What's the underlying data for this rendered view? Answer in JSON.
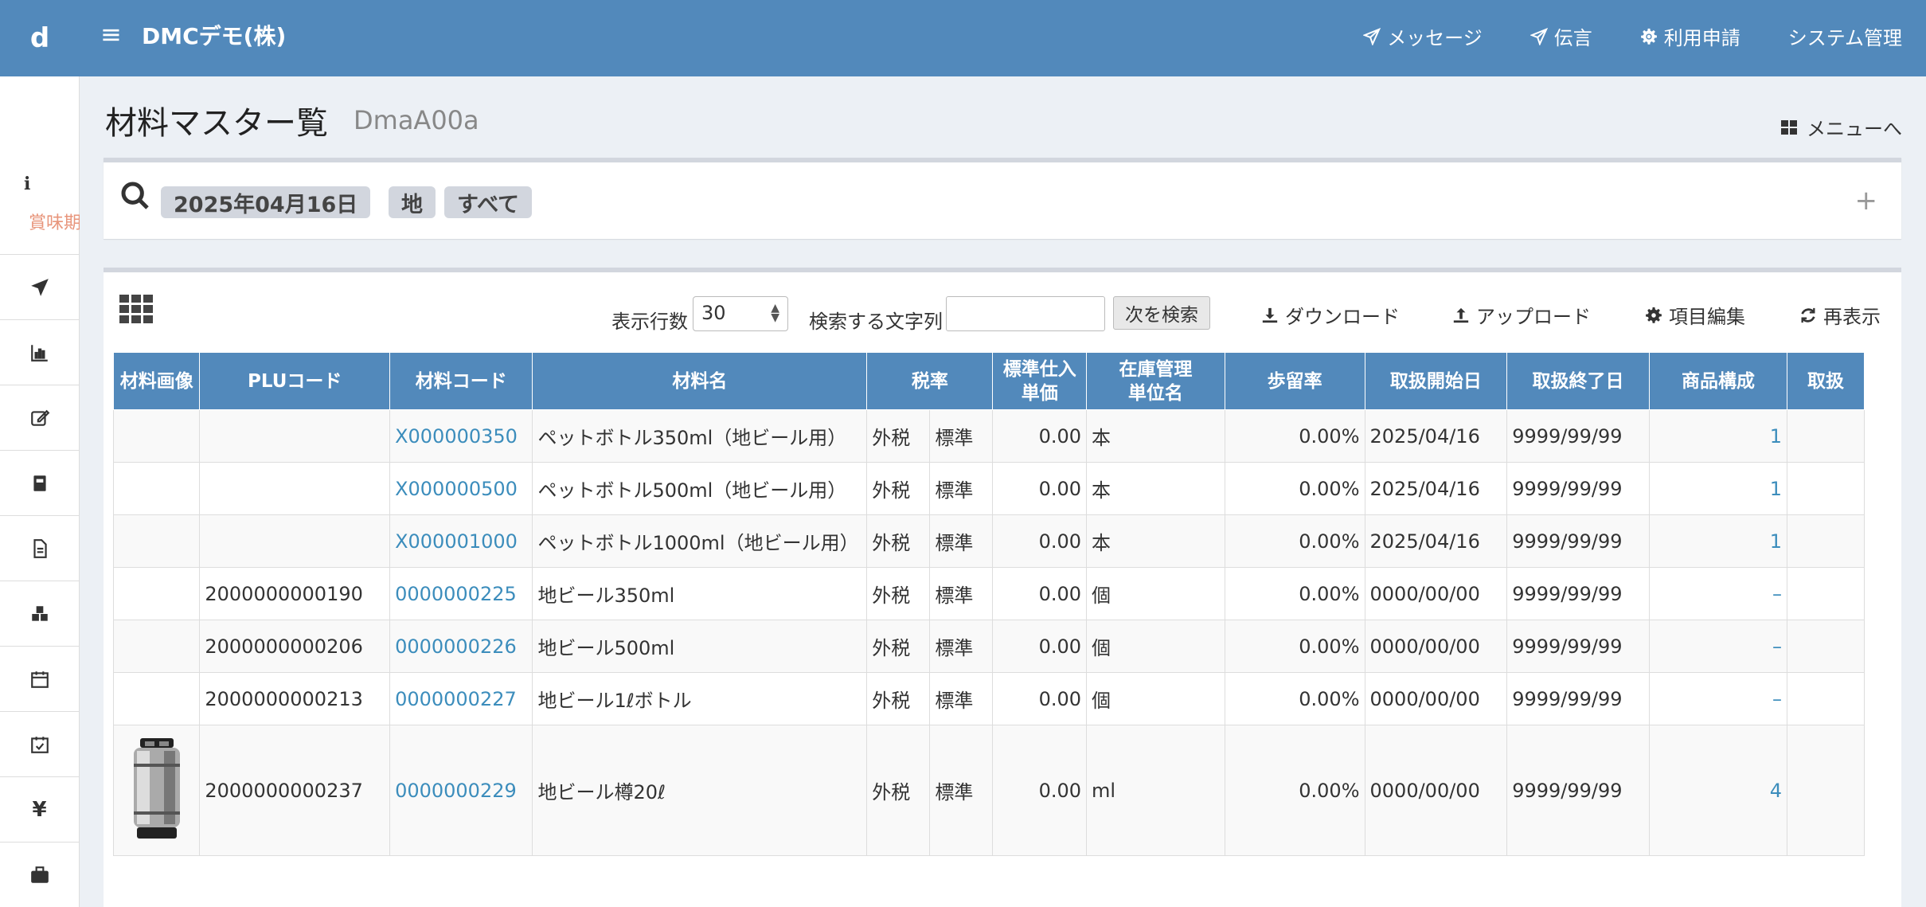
{
  "app": {
    "logo": "d",
    "company": "DMCデモ(株)",
    "nav": [
      {
        "label": "メッセージ",
        "icon": "send-icon"
      },
      {
        "label": "伝言",
        "icon": "send-icon"
      },
      {
        "label": "利用申請",
        "icon": "gear-icon"
      },
      {
        "label": "システム管理",
        "icon": ""
      }
    ]
  },
  "sidebar": {
    "info_label": "i",
    "expiry_label": "賞味期限",
    "items": [
      "send-icon",
      "bar-chart-icon",
      "edit-icon",
      "book-icon",
      "document-icon",
      "cubes-icon",
      "calendar-icon",
      "calendar-check-icon",
      "yen-icon",
      "briefcase-icon"
    ]
  },
  "page": {
    "title": "材料マスター覧",
    "code": "DmaA00a",
    "menu_link": "メニューへ"
  },
  "search": {
    "chips": [
      "2025年04月16日",
      "地",
      "すべて"
    ],
    "expand": "+"
  },
  "toolbar": {
    "rows_label": "表示行数",
    "rows_value": "30",
    "search_label": "検索する文字列",
    "search_value": "",
    "next_button": "次を検索",
    "download": "ダウンロード",
    "upload": "アップロード",
    "edit_items": "項目編集",
    "refresh": "再表示"
  },
  "table": {
    "headers": [
      "材料画像",
      "PLUコード",
      "材料コード",
      "材料名",
      "税率",
      "標準仕入\n単価",
      "在庫管理\n単位名",
      "歩留率",
      "取扱開始日",
      "取扱終了日",
      "商品構成",
      "取扱"
    ],
    "rows": [
      {
        "image": false,
        "plu": "",
        "code": "X000000350",
        "name": "ペットボトル350ml（地ビール用）",
        "tax1": "外税",
        "tax2": "標準",
        "price": "0.00",
        "unit": "本",
        "yield": "0.00%",
        "start": "2025/04/16",
        "end": "9999/99/99",
        "composition": "1"
      },
      {
        "image": false,
        "plu": "",
        "code": "X000000500",
        "name": "ペットボトル500ml（地ビール用）",
        "tax1": "外税",
        "tax2": "標準",
        "price": "0.00",
        "unit": "本",
        "yield": "0.00%",
        "start": "2025/04/16",
        "end": "9999/99/99",
        "composition": "1"
      },
      {
        "image": false,
        "plu": "",
        "code": "X000001000",
        "name": "ペットボトル1000ml（地ビール用）",
        "tax1": "外税",
        "tax2": "標準",
        "price": "0.00",
        "unit": "本",
        "yield": "0.00%",
        "start": "2025/04/16",
        "end": "9999/99/99",
        "composition": "1"
      },
      {
        "image": false,
        "plu": "2000000000190",
        "code": "0000000225",
        "name": "地ビール350ml",
        "tax1": "外税",
        "tax2": "標準",
        "price": "0.00",
        "unit": "個",
        "yield": "0.00%",
        "start": "0000/00/00",
        "end": "9999/99/99",
        "composition": "–"
      },
      {
        "image": false,
        "plu": "2000000000206",
        "code": "0000000226",
        "name": "地ビール500ml",
        "tax1": "外税",
        "tax2": "標準",
        "price": "0.00",
        "unit": "個",
        "yield": "0.00%",
        "start": "0000/00/00",
        "end": "9999/99/99",
        "composition": "–"
      },
      {
        "image": false,
        "plu": "2000000000213",
        "code": "0000000227",
        "name": "地ビール1ℓボトル",
        "tax1": "外税",
        "tax2": "標準",
        "price": "0.00",
        "unit": "個",
        "yield": "0.00%",
        "start": "0000/00/00",
        "end": "9999/99/99",
        "composition": "–"
      },
      {
        "image": true,
        "plu": "2000000000237",
        "code": "0000000229",
        "name": "地ビール樽20ℓ",
        "tax1": "外税",
        "tax2": "標準",
        "price": "0.00",
        "unit": "ml",
        "yield": "0.00%",
        "start": "0000/00/00",
        "end": "9999/99/99",
        "composition": "4"
      }
    ]
  },
  "colors": {
    "header": "#5289bb",
    "link": "#3c8dbc",
    "expiry": "#e8957b"
  }
}
